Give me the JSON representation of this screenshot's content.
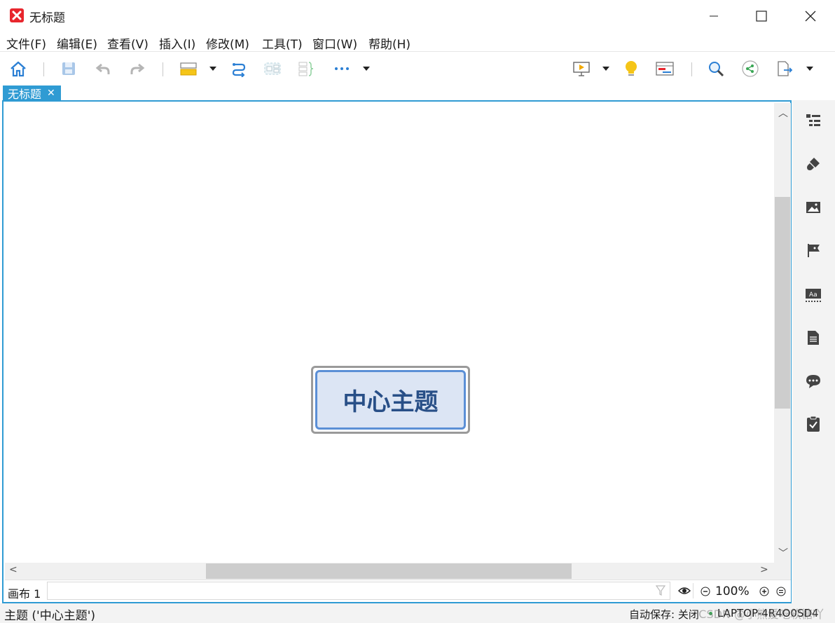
{
  "window": {
    "title": "无标题"
  },
  "menu": {
    "items": [
      "文件(F)",
      "编辑(E)",
      "查看(V)",
      "插入(I)",
      "修改(M)",
      "工具(T)",
      "窗口(W)",
      "帮助(H)"
    ]
  },
  "tab": {
    "label": "无标题",
    "close": "✕"
  },
  "canvas": {
    "central_topic": "中心主题"
  },
  "statusrow": {
    "sheet_label": "画布 1",
    "zoom": "100%"
  },
  "statusbar": {
    "left": "主题 ('中心主题')",
    "autosave": "自动保存: 关闭",
    "machine": "LAPTOP-4R4O0SD4",
    "watermark": "CSDN @小熊爱吃软糖吖"
  },
  "colors": {
    "accent": "#2f9bd3",
    "topic_fill": "#dce5f4",
    "topic_border": "#5b8fd6",
    "topic_text": "#284f87"
  },
  "toolbar_icons": [
    "home-icon",
    "save-icon",
    "undo-icon",
    "redo-icon",
    "topic-style-icon",
    "relationship-icon",
    "boundary-icon",
    "summary-icon",
    "more-icon",
    "presentation-icon",
    "idea-icon",
    "gantt-icon",
    "search-icon",
    "share-icon",
    "export-icon"
  ],
  "rightbar_icons": [
    "outline-icon",
    "format-brush-icon",
    "image-icon",
    "marker-flag-icon",
    "style-aa-icon",
    "note-icon",
    "comment-icon",
    "task-icon"
  ]
}
